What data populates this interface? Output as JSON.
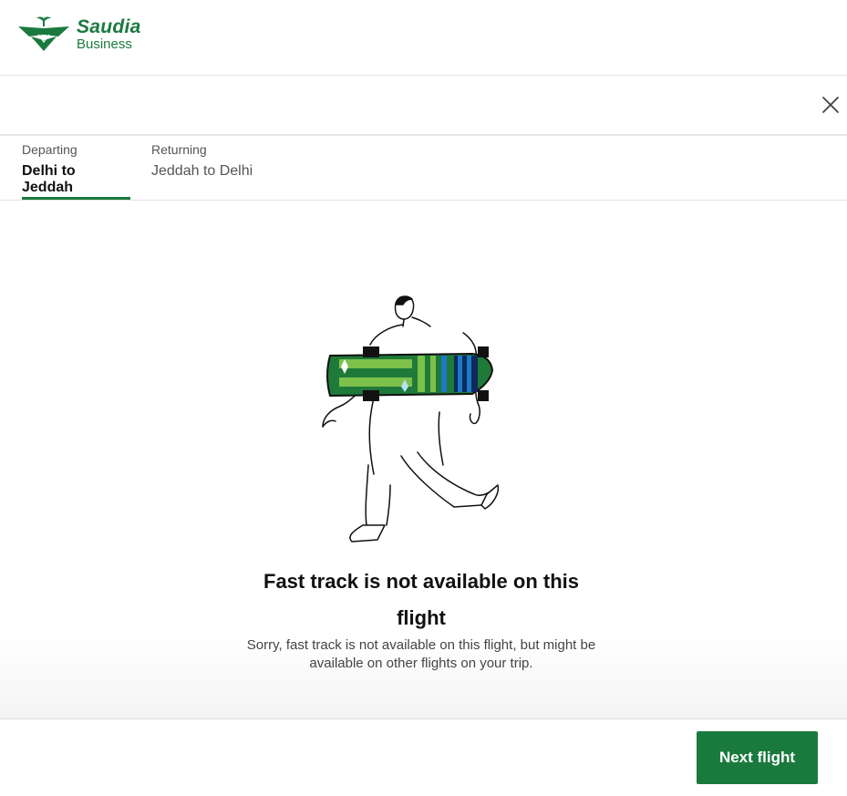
{
  "brand": {
    "name": "Saudia",
    "sub": "Business",
    "color": "#1a7a3e"
  },
  "header": {
    "close_icon": "close-icon"
  },
  "tabs": [
    {
      "sub": "Departing",
      "label": "Delhi to Jeddah",
      "active": true
    },
    {
      "sub": "Returning",
      "label": "Jeddah to Delhi",
      "active": false
    }
  ],
  "main": {
    "title": "Fast track is not available on this flight",
    "description": "Sorry, fast track is not available on this flight, but might be available on other flights on your trip.",
    "illustration": "person-carrying-skateboard-illustration"
  },
  "footer": {
    "next_label": "Next flight"
  },
  "colors": {
    "accent": "#1a7a3e",
    "board_green": "#1f7a3a",
    "board_light": "#7dc04a",
    "board_blue": "#1e78c8",
    "board_navy": "#0e2a5a"
  }
}
